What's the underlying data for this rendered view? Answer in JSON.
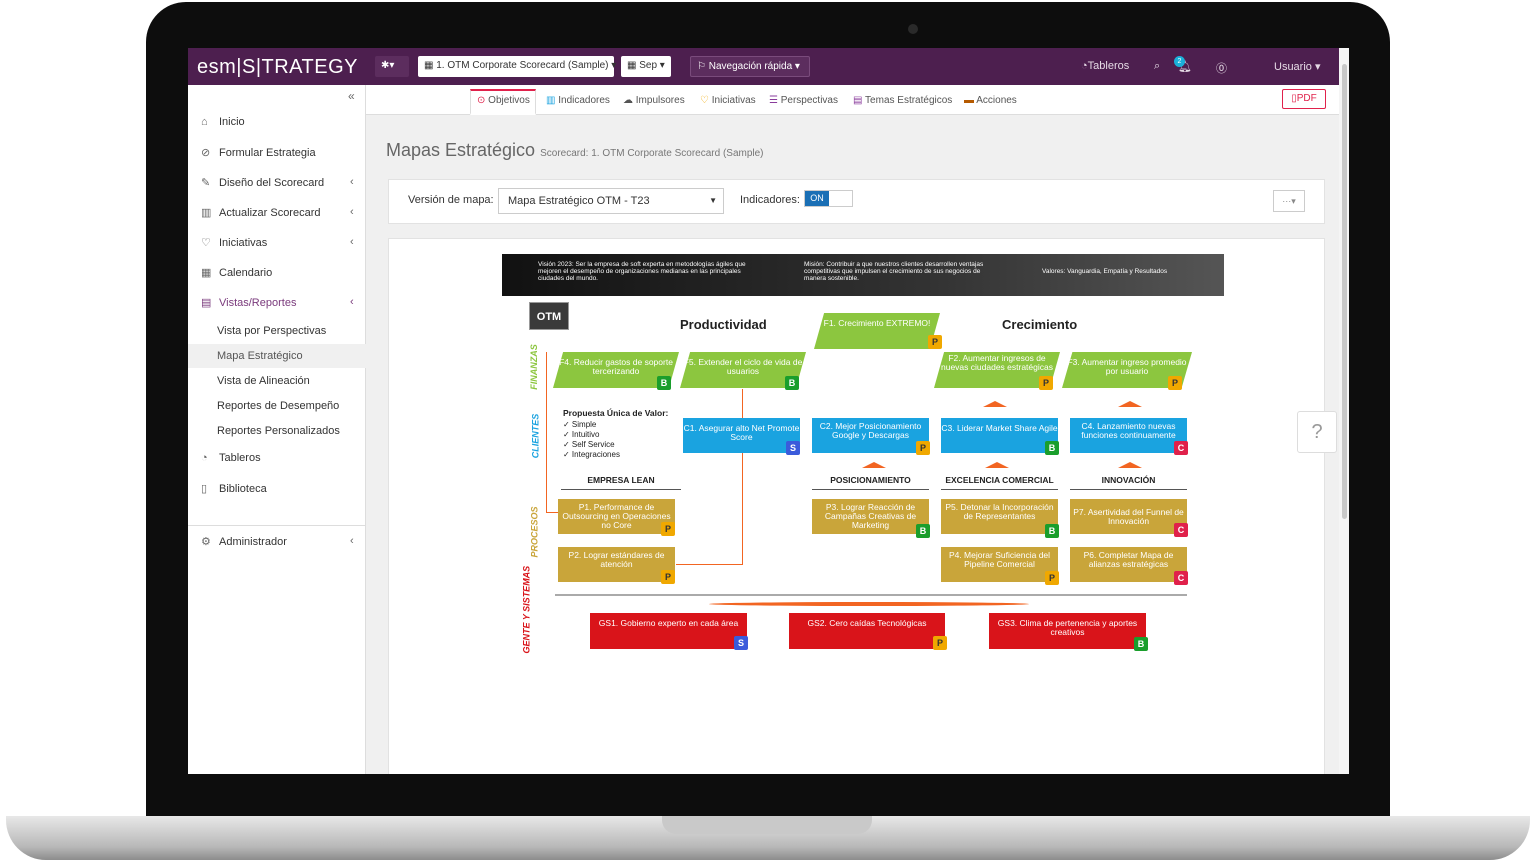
{
  "app": {
    "logo": "esm|S|TRATEGY"
  },
  "topbar": {
    "scorecard": "1. OTM Corporate Scorecard (Sample)",
    "period": "Sep",
    "quick_nav": "Navegación rápida",
    "dashboards": "Tableros",
    "notif_count": "2",
    "user": "Usuario"
  },
  "sidebar": {
    "items": [
      {
        "label": "Inicio"
      },
      {
        "label": "Formular Estrategia"
      },
      {
        "label": "Diseño del Scorecard"
      },
      {
        "label": "Actualizar Scorecard"
      },
      {
        "label": "Iniciativas"
      },
      {
        "label": "Calendario"
      },
      {
        "label": "Vistas/Reportes"
      },
      {
        "label": "Tableros"
      },
      {
        "label": "Biblioteca"
      },
      {
        "label": "Administrador"
      }
    ],
    "subitems": [
      {
        "label": "Vista por Perspectivas"
      },
      {
        "label": "Mapa Estratégico"
      },
      {
        "label": "Vista de Alineación"
      },
      {
        "label": "Reportes de Desempeño"
      },
      {
        "label": "Reportes Personalizados"
      }
    ]
  },
  "tabs": [
    "Objetivos",
    "Indicadores",
    "Impulsores",
    "Iniciativas",
    "Perspectivas",
    "Temas Estratégicos",
    "Acciones"
  ],
  "pdf_label": "PDF",
  "page": {
    "title": "Mapas Estratégico",
    "subtitle": "Scorecard: 1. OTM Corporate Scorecard (Sample)"
  },
  "controls": {
    "version_label": "Versión de mapa:",
    "version_value": "Mapa Estratégico OTM - T23",
    "indicators_label": "Indicadores:",
    "toggle_on": "ON",
    "menu": "···"
  },
  "map": {
    "vision": "Visión 2023: Ser la empresa de soft experta en metodologías ágiles que mejoren el desempeño de organizaciones medianas en las principales ciudades del mundo.",
    "mission": "Misión: Contribuir a que nuestros clientes desarrollen ventajas competitivas que impulsen el crecimiento de sus negocios de manera sostenible.",
    "values": "Valores: Vanguardia, Empatía y Resultados",
    "org": "OTM",
    "heading_left": "Productividad",
    "heading_right": "Crecimiento",
    "perspectives": [
      "FINANZAS",
      "CLIENTES",
      "PROCESOS",
      "GENTE Y SISTEMAS"
    ],
    "value_prop_title": "Propuesta Única de Valor:",
    "value_prop": [
      "✓ Simple",
      "✓ Intuitivo",
      "✓ Self Service",
      "✓ Integraciones"
    ],
    "themes": [
      "EMPRESA LEAN",
      "POSICIONAMIENTO",
      "EXCELENCIA COMERCIAL",
      "INNOVACIÓN"
    ],
    "objectives": {
      "f1": {
        "text": "F1. Crecimiento EXTREMO!",
        "badge": "P"
      },
      "f4": {
        "text": "F4. Reducir gastos de soporte tercerizando",
        "badge": "B"
      },
      "f5": {
        "text": "F5. Extender el ciclo de vida de usuarios",
        "badge": "B"
      },
      "f2": {
        "text": "F2. Aumentar ingresos de nuevas ciudades estratégicas",
        "badge": "P"
      },
      "f3": {
        "text": "F3. Aumentar ingreso promedio por usuario",
        "badge": "P"
      },
      "c1": {
        "text": "C1. Asegurar alto Net Promote Score",
        "badge": "S"
      },
      "c2": {
        "text": "C2. Mejor Posicionamiento Google y Descargas",
        "badge": "P"
      },
      "c3": {
        "text": "C3. Liderar Market Share Agile",
        "badge": "B"
      },
      "c4": {
        "text": "C4. Lanzamiento nuevas funciones continuamente",
        "badge": "C"
      },
      "p1": {
        "text": "P1. Performance de Outsourcing en Operaciones no Core",
        "badge": "P"
      },
      "p2": {
        "text": "P2. Lograr estándares de atención",
        "badge": "P"
      },
      "p3": {
        "text": "P3. Lograr Reacción de Campañas Creativas de Marketing",
        "badge": "B"
      },
      "p5": {
        "text": "P5. Detonar la Incorporación de Representantes",
        "badge": "B"
      },
      "p4": {
        "text": "P4. Mejorar Suficiencia del Pipeline Comercial",
        "badge": "P"
      },
      "p7": {
        "text": "P7. Asertividad del Funnel de Innovación",
        "badge": "C"
      },
      "p6": {
        "text": "P6. Completar Mapa de alianzas estratégicas",
        "badge": "C"
      },
      "gs1": {
        "text": "GS1. Gobierno experto en cada área",
        "badge": "S"
      },
      "gs2": {
        "text": "GS2. Cero caídas Tecnológicas",
        "badge": "P"
      },
      "gs3": {
        "text": "GS3. Clima de pertenencia y aportes creativos",
        "badge": "B"
      }
    }
  },
  "colors": {
    "topbar": "#4d1f4f",
    "finance": "#8cc63f",
    "clients": "#1aa3e0",
    "process": "#c9a53a",
    "people": "#d9141a",
    "accent": "#f26522"
  }
}
